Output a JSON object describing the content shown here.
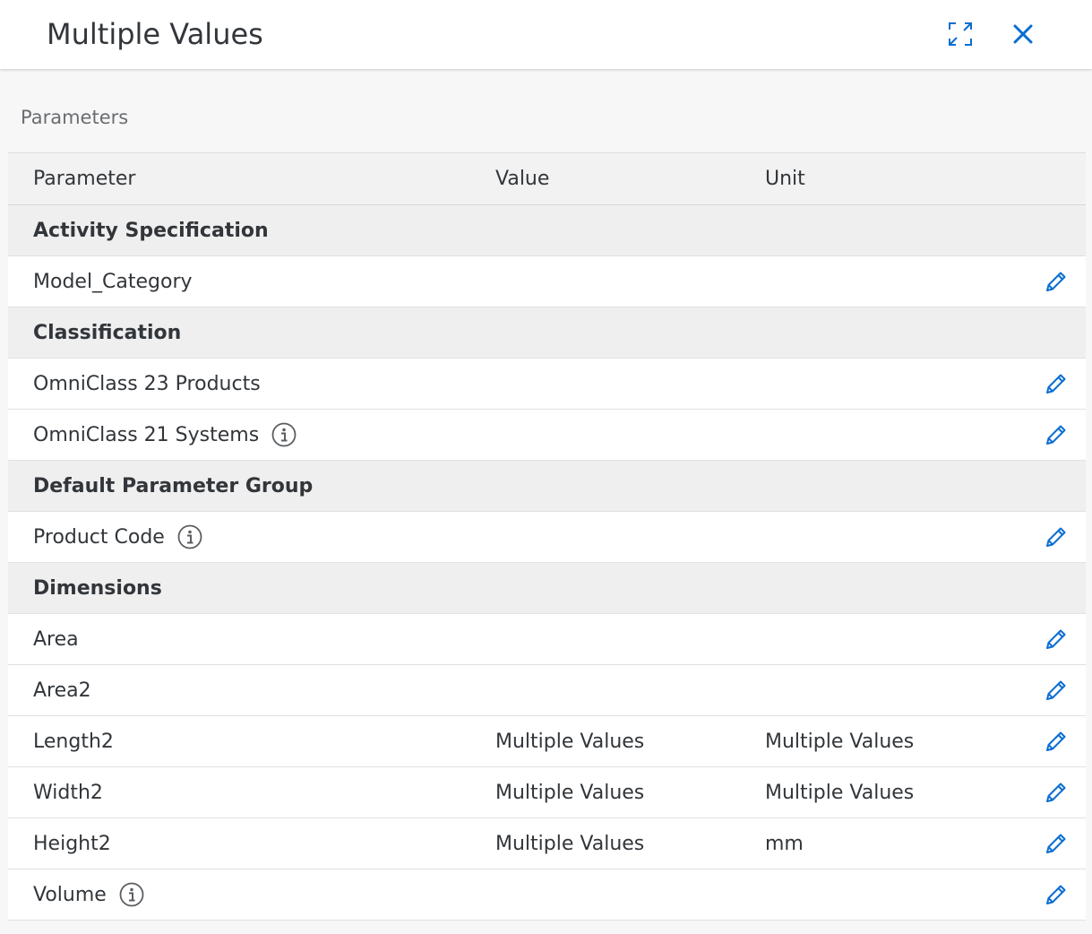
{
  "dialog": {
    "title": "Multiple Values",
    "accent_color": "#0a6ed1"
  },
  "section": {
    "label": "Parameters"
  },
  "table": {
    "columns": [
      "Parameter",
      "Value",
      "Unit"
    ],
    "rows": [
      {
        "type": "group",
        "parameter": "Activity Specification"
      },
      {
        "type": "item",
        "parameter": "Model_Category",
        "value": "",
        "unit": "",
        "info": false
      },
      {
        "type": "group",
        "parameter": "Classification"
      },
      {
        "type": "item",
        "parameter": "OmniClass 23 Products",
        "value": "",
        "unit": "",
        "info": false
      },
      {
        "type": "item",
        "parameter": "OmniClass 21 Systems",
        "value": "",
        "unit": "",
        "info": true
      },
      {
        "type": "group",
        "parameter": "Default Parameter Group"
      },
      {
        "type": "item",
        "parameter": "Product Code",
        "value": "",
        "unit": "",
        "info": true
      },
      {
        "type": "group",
        "parameter": "Dimensions"
      },
      {
        "type": "item",
        "parameter": "Area",
        "value": "",
        "unit": "",
        "info": false
      },
      {
        "type": "item",
        "parameter": "Area2",
        "value": "",
        "unit": "",
        "info": false
      },
      {
        "type": "item",
        "parameter": "Length2",
        "value": "Multiple Values",
        "unit": "Multiple Values",
        "info": false
      },
      {
        "type": "item",
        "parameter": "Width2",
        "value": "Multiple Values",
        "unit": "Multiple Values",
        "info": false
      },
      {
        "type": "item",
        "parameter": "Height2",
        "value": "Multiple Values",
        "unit": "mm",
        "info": false
      },
      {
        "type": "item",
        "parameter": "Volume",
        "value": "",
        "unit": "",
        "info": true
      }
    ]
  },
  "icons": {
    "expand": "expand-icon",
    "close": "close-icon",
    "edit": "pencil-icon",
    "info": "info-icon"
  }
}
